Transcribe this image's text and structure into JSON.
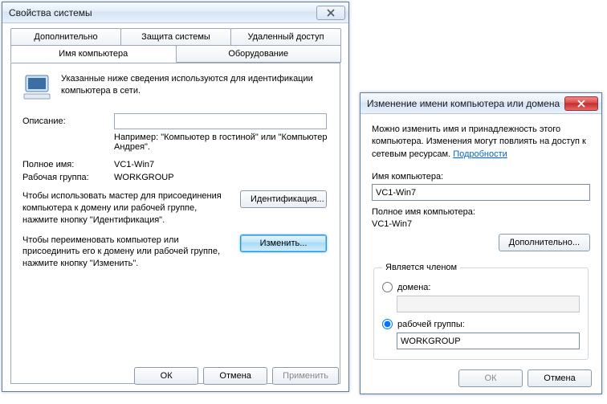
{
  "win1": {
    "title": "Свойства системы",
    "tabs": {
      "advanced": "Дополнительно",
      "protection": "Защита системы",
      "remote": "Удаленный доступ",
      "computer_name": "Имя компьютера",
      "hardware": "Оборудование"
    },
    "info_text": "Указанные ниже сведения используются для идентификации компьютера в сети.",
    "description_label": "Описание:",
    "description_value": "",
    "description_hint": "Например: \"Компьютер в гостиной\" или \"Компьютер Андрея\".",
    "fullname_label": "Полное имя:",
    "fullname_value": "VC1-Win7",
    "workgroup_label": "Рабочая группа:",
    "workgroup_value": "WORKGROUP",
    "id_text": "Чтобы использовать мастер для присоединения компьютера к домену или рабочей группе, нажмите кнопку \"Идентификация\".",
    "id_button": "Идентификация...",
    "change_text": "Чтобы переименовать компьютер или присоединить его к домену или рабочей группе, нажмите кнопку \"Изменить\".",
    "change_button": "Изменить...",
    "ok": "ОК",
    "cancel": "Отмена",
    "apply": "Применить"
  },
  "win2": {
    "title": "Изменение имени компьютера или домена",
    "intro_a": "Можно изменить имя и принадлежность этого компьютера. Изменения могут повлиять на доступ к сетевым ресурсам. ",
    "intro_link": "Подробности",
    "name_label": "Имя компьютера:",
    "name_value": "VC1-Win7",
    "fullname_label": "Полное имя компьютера:",
    "fullname_value": "VC1-Win7",
    "more_button": "Дополнительно...",
    "member_legend": "Является членом",
    "domain_label": "домена:",
    "domain_value": "",
    "workgroup_label": "рабочей группы:",
    "workgroup_value": "WORKGROUP",
    "ok": "ОК",
    "cancel": "Отмена"
  }
}
